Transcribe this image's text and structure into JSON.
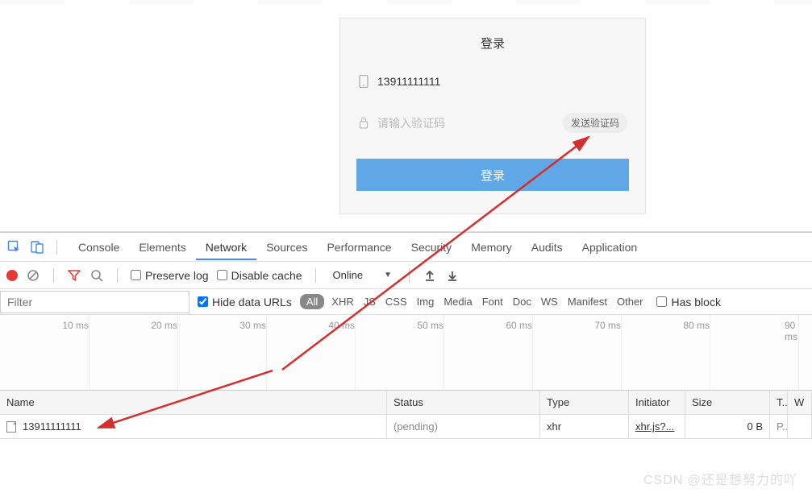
{
  "login": {
    "title": "登录",
    "phone_value": "13911111111",
    "code_placeholder": "请输入验证码",
    "send_code_label": "发送验证码",
    "submit_label": "登录"
  },
  "devtools": {
    "tabs": [
      "Console",
      "Elements",
      "Network",
      "Sources",
      "Performance",
      "Security",
      "Memory",
      "Audits",
      "Application"
    ],
    "active_tab": "Network"
  },
  "controls": {
    "preserve_log_label": "Preserve log",
    "disable_cache_label": "Disable cache",
    "throttle_value": "Online"
  },
  "filter": {
    "placeholder": "Filter",
    "hide_data_urls_label": "Hide data URLs",
    "hide_data_urls_checked": true,
    "types": [
      "All",
      "XHR",
      "JS",
      "CSS",
      "Img",
      "Media",
      "Font",
      "Doc",
      "WS",
      "Manifest",
      "Other"
    ],
    "active_type": "All",
    "has_blocked_label": "Has block"
  },
  "timeline": {
    "ticks": [
      "10 ms",
      "20 ms",
      "30 ms",
      "40 ms",
      "50 ms",
      "60 ms",
      "70 ms",
      "80 ms",
      "90 ms"
    ]
  },
  "table": {
    "headers": {
      "name": "Name",
      "status": "Status",
      "type": "Type",
      "initiator": "Initiator",
      "size": "Size",
      "time": "T...",
      "waterfall": "W"
    },
    "rows": [
      {
        "name": "13911111111",
        "status": "(pending)",
        "type": "xhr",
        "initiator": "xhr.js?...",
        "size": "0 B",
        "time": "P..."
      }
    ]
  },
  "watermark": "CSDN @还是想努力的吖"
}
